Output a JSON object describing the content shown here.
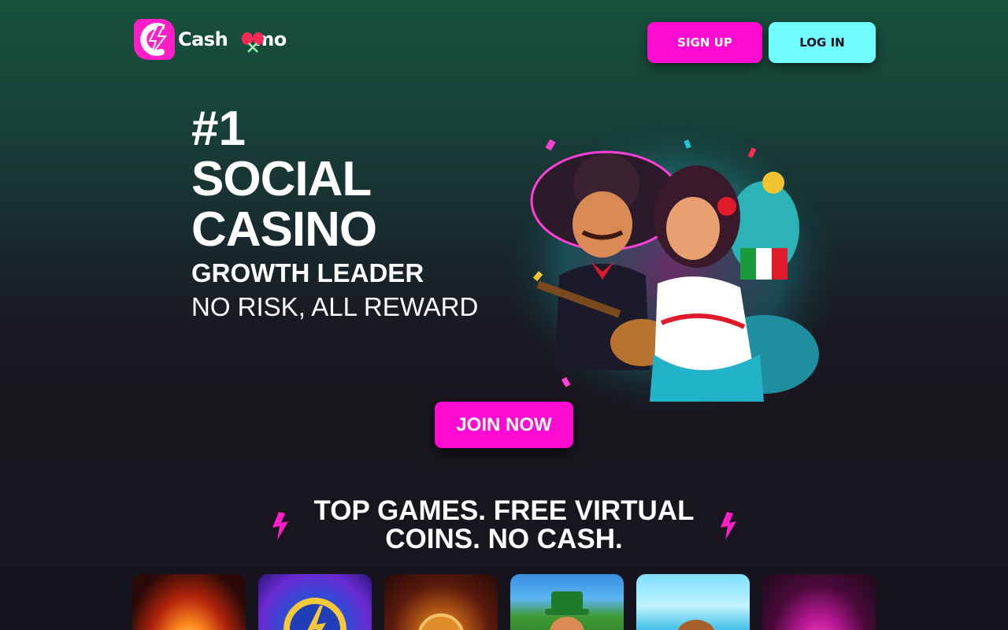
{
  "header": {
    "logo_text": "Cashmomo",
    "logo_text_before": "Cash",
    "logo_text_after": "mo",
    "signup_label": "SIGN UP",
    "login_label": "LOG IN"
  },
  "hero": {
    "rank": "#1",
    "line1": "SOCIAL",
    "line2": "CASINO",
    "subtitle": "GROWTH LEADER",
    "tagline": "NO RISK, ALL REWARD",
    "cta_label": "JOIN NOW"
  },
  "games_section": {
    "title_line1": "TOP GAMES. FREE VIRTUAL",
    "title_line2": "COINS. NO CASH."
  },
  "colors": {
    "accent_pink": "#ff0ad1",
    "accent_cyan": "#6ffdff",
    "bg_top": "#17523a",
    "bg_bottom": "#18141d"
  },
  "icons": {
    "logo": "cashmomo-logo-icon",
    "maracas": "maracas-icon",
    "bolt": "lightning-bolt-icon"
  }
}
